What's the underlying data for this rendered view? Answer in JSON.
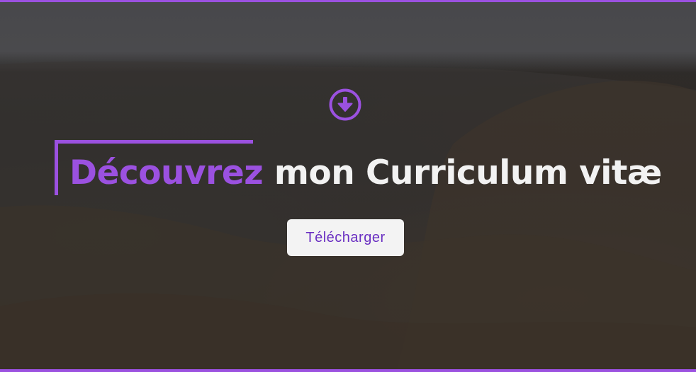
{
  "hero": {
    "title_accent": "Découvrez",
    "title_rest": " mon Curriculum vitæ",
    "download_button_label": "Télécharger",
    "icon": "arrow-circle-down-icon",
    "accent_color": "#9b51e0"
  }
}
